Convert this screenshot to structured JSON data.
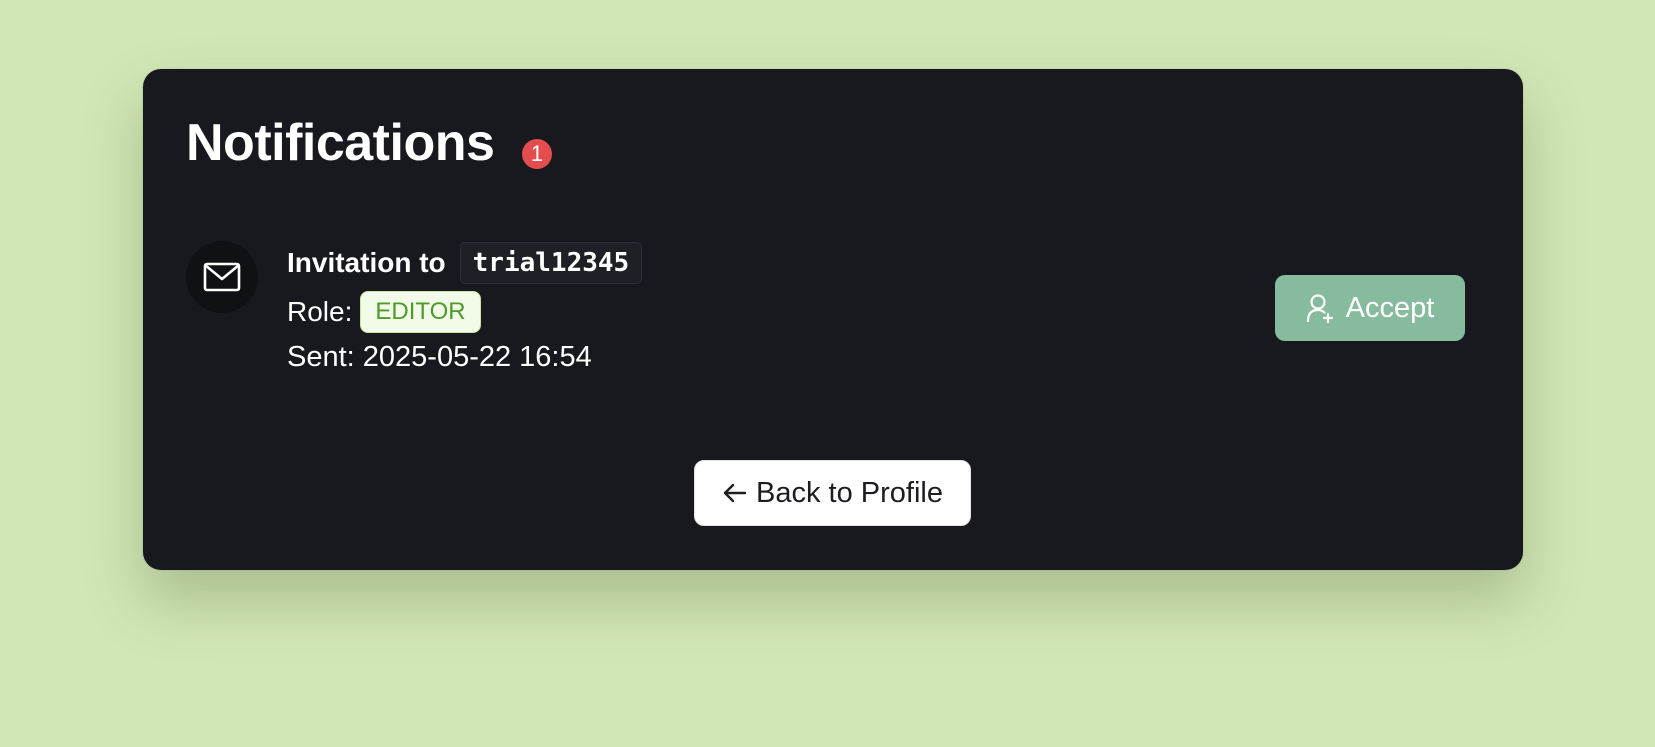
{
  "header": {
    "title": "Notifications",
    "unread_count": "1"
  },
  "notifications": [
    {
      "icon": "mail-icon",
      "title_prefix": "Invitation to",
      "target": "trial12345",
      "role_label": "Role:",
      "role_value": "EDITOR",
      "sent": "Sent: 2025-05-22 16:54",
      "accept_label": "Accept",
      "accept_icon": "user-plus-icon"
    }
  ],
  "footer": {
    "back_label": "Back to Profile",
    "back_icon": "arrow-left-icon"
  },
  "colors": {
    "page_background": "#d2e7b6",
    "card_background": "#18191f",
    "badge_red": "#e44d4d",
    "accept_green": "#86bb9e",
    "role_text": "#4e9a2a"
  }
}
